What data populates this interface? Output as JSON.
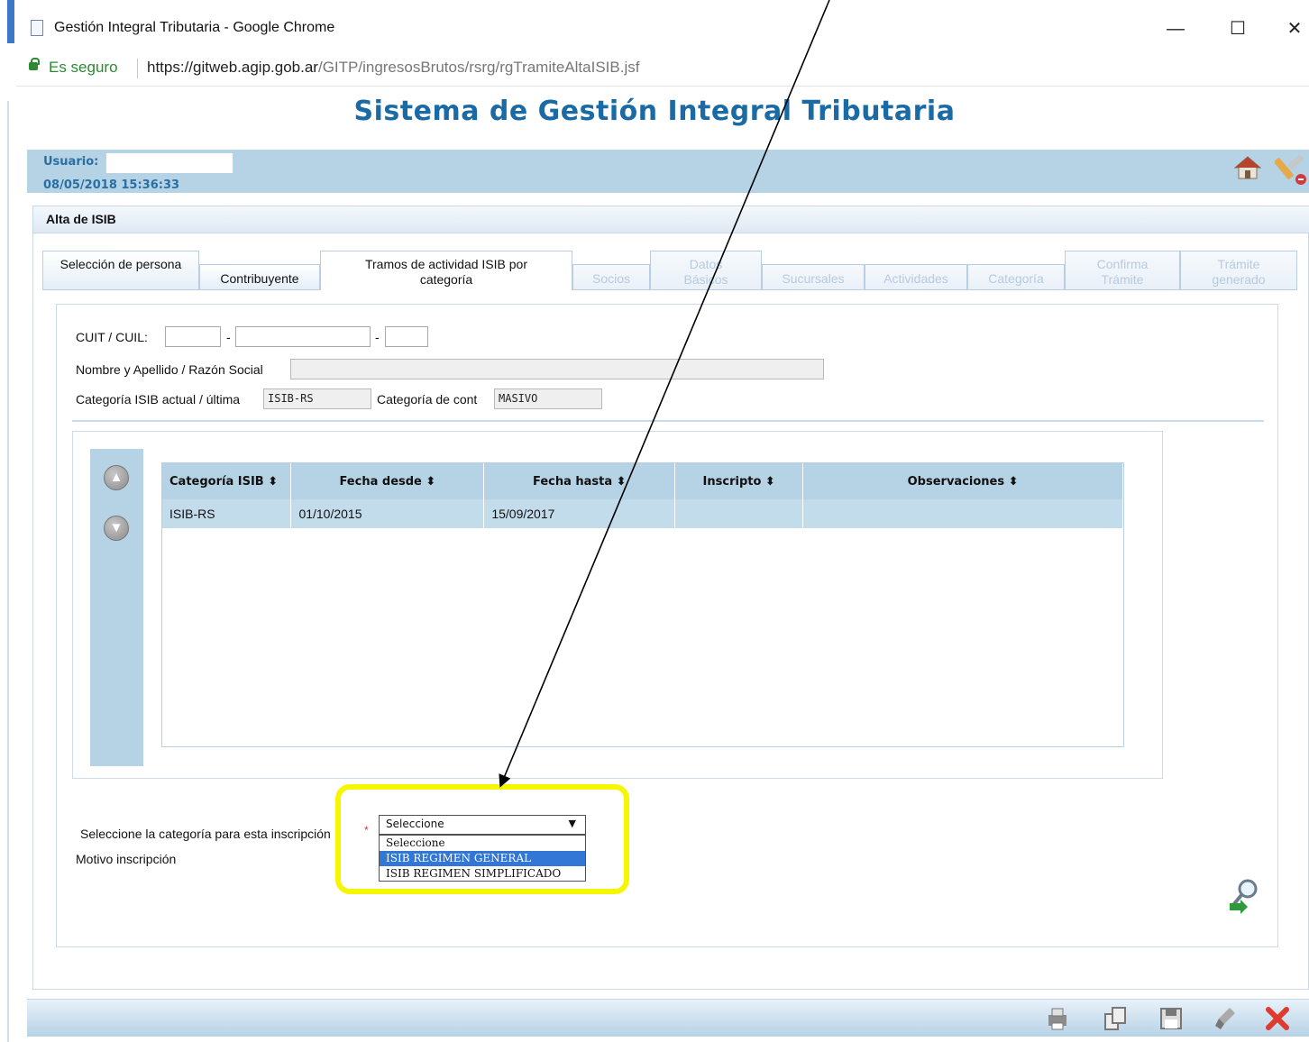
{
  "window": {
    "title": "Gestión Integral Tributaria - Google Chrome",
    "minimize": "—",
    "maximize": "☐",
    "close": "✕"
  },
  "urlbar": {
    "secure_label": "Es seguro",
    "url_host": "https://gitweb.agip.gob.ar",
    "url_path": "/GITP/ingresosBrutos/rsrg/rgTramiteAltaISIB.jsf"
  },
  "app": {
    "title": "Sistema de Gestión Integral Tributaria",
    "user_label": "Usuario:",
    "datetime": "08/05/2018 15:36:33",
    "home_icon": "home-icon",
    "tools_icon": "tools-icon"
  },
  "panel": {
    "title": "Alta de ISIB"
  },
  "tabs": [
    {
      "label": "Selección de persona",
      "state": "normal"
    },
    {
      "label": "Contribuyente",
      "state": "normal"
    },
    {
      "label": "Tramos de actividad ISIB por categoría",
      "state": "active"
    },
    {
      "label": "Socios",
      "state": "disabled"
    },
    {
      "label": "Datos Básicos",
      "state": "disabled"
    },
    {
      "label": "Sucursales",
      "state": "disabled"
    },
    {
      "label": "Actividades",
      "state": "disabled"
    },
    {
      "label": "Categoría",
      "state": "disabled"
    },
    {
      "label": "Confirma Trámite",
      "state": "disabled"
    },
    {
      "label": "Trámite generado",
      "state": "disabled"
    }
  ],
  "form": {
    "cuit_label": "CUIT / CUIL:",
    "dash": "-",
    "nombre_label": "Nombre y Apellido / Razón Social",
    "categoria_actual_label": "Categoría ISIB actual / última",
    "categoria_actual_value": "ISIB-RS",
    "categoria_cont_label": "Categoría de cont",
    "categoria_cont_value": "MASIVO"
  },
  "grid": {
    "columns": [
      "Categoría ISIB ⬍",
      "Fecha desde ⬍",
      "Fecha hasta ⬍",
      "Inscripto ⬍",
      "Observaciones ⬍"
    ],
    "rows": [
      [
        "ISIB-RS",
        "01/10/2015",
        "15/09/2017",
        "",
        ""
      ]
    ],
    "up_arrow": "▲",
    "down_arrow": "▼"
  },
  "selection": {
    "label": "Seleccione la categoría para esta inscripción",
    "required_mark": "*",
    "motivo_label": "Motivo inscripción",
    "current_value": "Seleccione",
    "caret": "▼",
    "options": [
      "Seleccione",
      "ISIB REGIMEN GENERAL",
      "ISIB REGIMEN SIMPLIFICADO"
    ],
    "highlighted_option": "ISIB REGIMEN GENERAL"
  },
  "colors": {
    "accent": "#1a6aa5",
    "band": "#b6d3e5",
    "highlight_box": "#f6f600",
    "dropdown_selected": "#3276d6"
  }
}
